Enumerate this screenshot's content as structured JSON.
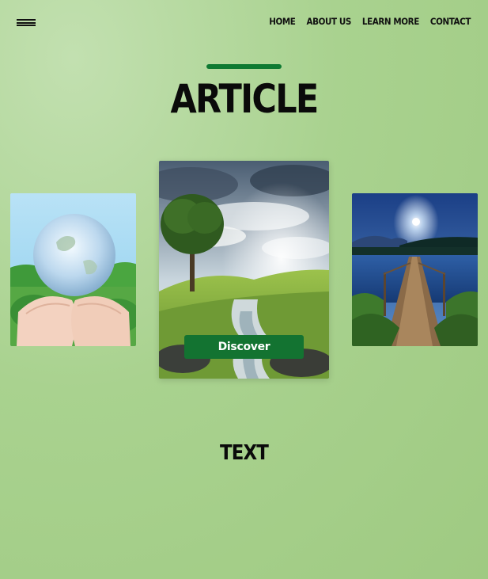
{
  "nav": {
    "items": [
      {
        "label": "HOME"
      },
      {
        "label": "ABOUT US"
      },
      {
        "label": "LEARN MORE"
      },
      {
        "label": "CONTACT"
      }
    ]
  },
  "hero": {
    "title": "ARTICLE"
  },
  "carousel": {
    "cards": [
      {
        "image": "globe-in-hands-image"
      },
      {
        "image": "tree-landscape-stream-image",
        "button_label": "Discover"
      },
      {
        "image": "lake-pier-night-image"
      }
    ]
  },
  "section": {
    "title": "TEXT"
  },
  "colors": {
    "accent": "#0f7a32",
    "button": "#137331",
    "background": "#a9d28f"
  }
}
